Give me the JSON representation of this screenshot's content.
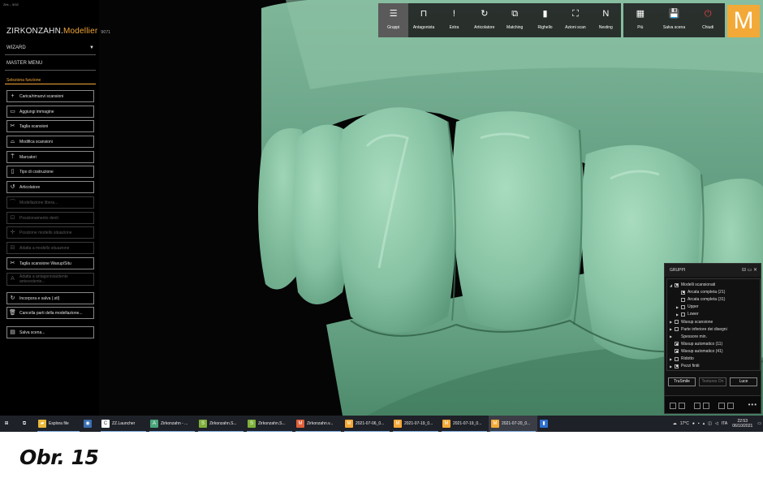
{
  "window_title": "Zirk – 5/02",
  "brand": {
    "name_part1": "ZIRKONZAHN.",
    "name_part2": "Modellier",
    "version": "9071"
  },
  "menu": {
    "wizard": "WIZARD",
    "master_menu": "MASTER MENU",
    "section_label": "Seleziona funzione"
  },
  "functions": [
    {
      "label": "Carica/rimuovi scansioni",
      "icon": "plus-icon",
      "glyph": "+",
      "enabled": true
    },
    {
      "label": "Aggiungi immagine",
      "icon": "image-icon",
      "glyph": "▭",
      "enabled": true
    },
    {
      "label": "Taglia scansioni",
      "icon": "scissors-icon",
      "glyph": "✂",
      "enabled": true
    },
    {
      "label": "Modifica scansioni",
      "icon": "edit-scan-icon",
      "glyph": "⌓",
      "enabled": true
    },
    {
      "label": "Marcatori",
      "icon": "marker-icon",
      "glyph": "⍑",
      "enabled": true
    },
    {
      "label": "Tipo di costruzione",
      "icon": "construction-icon",
      "glyph": "▯",
      "enabled": true
    },
    {
      "label": "Articolatore",
      "icon": "articulator-icon",
      "glyph": "↺",
      "enabled": true
    },
    {
      "label": "Modellazione libera...",
      "icon": "free-model-icon",
      "glyph": "⌒",
      "enabled": false
    },
    {
      "label": "Posizionamento denti",
      "icon": "tooth-position-icon",
      "glyph": "⊡",
      "enabled": false
    },
    {
      "label": "Posizione modello situazione",
      "icon": "move-icon",
      "glyph": "✛",
      "enabled": false
    },
    {
      "label": "Adatta a modello situazione",
      "icon": "fit-icon",
      "glyph": "⊟",
      "enabled": false
    },
    {
      "label": "Taglia scansione Waxup/Situ",
      "icon": "scissors-icon",
      "glyph": "✂",
      "enabled": true
    },
    {
      "label": "Adatta a antagonista/dente antecedente...",
      "icon": "antagonist-icon",
      "glyph": "A",
      "enabled": false
    },
    {
      "label": "Incorpora e salva (.stl)",
      "icon": "embed-save-icon",
      "glyph": "↻",
      "enabled": true
    },
    {
      "label": "Cancella parti della modellazione...",
      "icon": "trash-icon",
      "glyph": "🗑",
      "enabled": true
    },
    {
      "label": "Salva scena...",
      "icon": "save-scene-icon",
      "glyph": "▤",
      "enabled": true
    }
  ],
  "toolbar": [
    {
      "label": "Gruppi",
      "icon": "menu-icon",
      "glyph": "☰",
      "active": true
    },
    {
      "label": "Antagonista",
      "icon": "antagonist-icon",
      "glyph": "⊓",
      "active": false
    },
    {
      "label": "Extra",
      "icon": "exclamation-icon",
      "glyph": "!",
      "active": false
    },
    {
      "label": "Articolatore",
      "icon": "articulator-icon",
      "glyph": "↻",
      "active": false
    },
    {
      "label": "Matching",
      "icon": "matching-icon",
      "glyph": "⧉",
      "active": false
    },
    {
      "label": "Righello",
      "icon": "ruler-icon",
      "glyph": "▮",
      "active": false
    },
    {
      "label": "Azioni scan",
      "icon": "scan-actions-icon",
      "glyph": "⛶",
      "active": false
    },
    {
      "label": "Nesting",
      "icon": "nesting-icon",
      "glyph": "N",
      "active": false
    }
  ],
  "toolbar_right": [
    {
      "label": "Più",
      "icon": "more-icon",
      "glyph": "▦"
    },
    {
      "label": "Salva scena",
      "icon": "save-icon",
      "glyph": "💾"
    },
    {
      "label": "Chiudi",
      "icon": "close-app-icon",
      "glyph": "⏻"
    }
  ],
  "logo_letter": "M",
  "gruppi": {
    "title": "GRUPPI",
    "controls": "⊟ ▭ ✕",
    "tree": [
      {
        "label": "Modelli scansionati",
        "level": 0,
        "expanded": true,
        "checked": true
      },
      {
        "label": "Arcata completa (21)",
        "level": 1,
        "expanded": null,
        "checked": true
      },
      {
        "label": "Arcata completa (31)",
        "level": 1,
        "expanded": null,
        "checked": false
      },
      {
        "label": "Upper",
        "level": 1,
        "expanded": false,
        "checked": false
      },
      {
        "label": "Lower",
        "level": 1,
        "expanded": false,
        "checked": false
      },
      {
        "label": "Waxup scansione",
        "level": 0,
        "expanded": false,
        "checked": false
      },
      {
        "label": "Parte inferiore dei disegni",
        "level": 0,
        "expanded": false,
        "checked": false
      },
      {
        "label": "Spessore min.",
        "level": 0,
        "expanded": false,
        "checked": null
      },
      {
        "label": "Waxup automatico (11)",
        "level": 0,
        "expanded": null,
        "checked": true
      },
      {
        "label": "Waxup automatico (41)",
        "level": 0,
        "expanded": null,
        "checked": true
      },
      {
        "label": "Ridotto",
        "level": 0,
        "expanded": false,
        "checked": false
      },
      {
        "label": "Pezzi finiti",
        "level": 0,
        "expanded": false,
        "checked": true
      }
    ],
    "buttons": [
      {
        "label": "TruSmile",
        "enabled": true
      },
      {
        "label": "Textures On",
        "enabled": false
      },
      {
        "label": "Luce",
        "enabled": true
      }
    ]
  },
  "taskbar": {
    "items": [
      {
        "label": "",
        "icon": "windows-start-icon",
        "glyph": "⊞",
        "color": "#1e2128"
      },
      {
        "label": "",
        "icon": "task-view-icon",
        "glyph": "⧉",
        "color": "#1e2128"
      },
      {
        "label": "Esplora file",
        "icon": "folder-icon",
        "glyph": "▰",
        "color": "#e9b83b"
      },
      {
        "label": "",
        "icon": "app-icon",
        "glyph": "◉",
        "color": "#3a6fb0"
      },
      {
        "label": "ZZ.Launcher",
        "icon": "launcher-icon",
        "glyph": "C",
        "color": "#ffffff"
      },
      {
        "label": "Zirkonzahn - ...",
        "icon": "zirkonzahn-icon",
        "glyph": "A",
        "color": "#4aa57a"
      },
      {
        "label": "Zirkonzahn.S...",
        "icon": "zirkonzahn-s-icon",
        "glyph": "S",
        "color": "#7fb03a"
      },
      {
        "label": "Zirkonzahn.S...",
        "icon": "zirkonzahn-s-icon",
        "glyph": "S",
        "color": "#7fb03a"
      },
      {
        "label": "Zirkonzahn.v...",
        "icon": "zirkonzahn-m-icon",
        "glyph": "M",
        "color": "#e0603a"
      },
      {
        "label": "2021-07-06_0...",
        "icon": "modellier-icon",
        "glyph": "M",
        "color": "#f3a937"
      },
      {
        "label": "2021-07-19_0...",
        "icon": "modellier-icon",
        "glyph": "M",
        "color": "#f3a937"
      },
      {
        "label": "2021-07-19_0...",
        "icon": "modellier-icon",
        "glyph": "M",
        "color": "#f3a937"
      },
      {
        "label": "2021-07-20_0...",
        "icon": "modellier-icon",
        "glyph": "M",
        "color": "#f3a937"
      },
      {
        "label": "",
        "icon": "blue-app-icon",
        "glyph": "▮",
        "color": "#2e6fd0"
      }
    ],
    "weather": "17°C",
    "language": "ITA",
    "time": "22:53",
    "date": "06/10/2021"
  },
  "caption": "Obr. 15"
}
